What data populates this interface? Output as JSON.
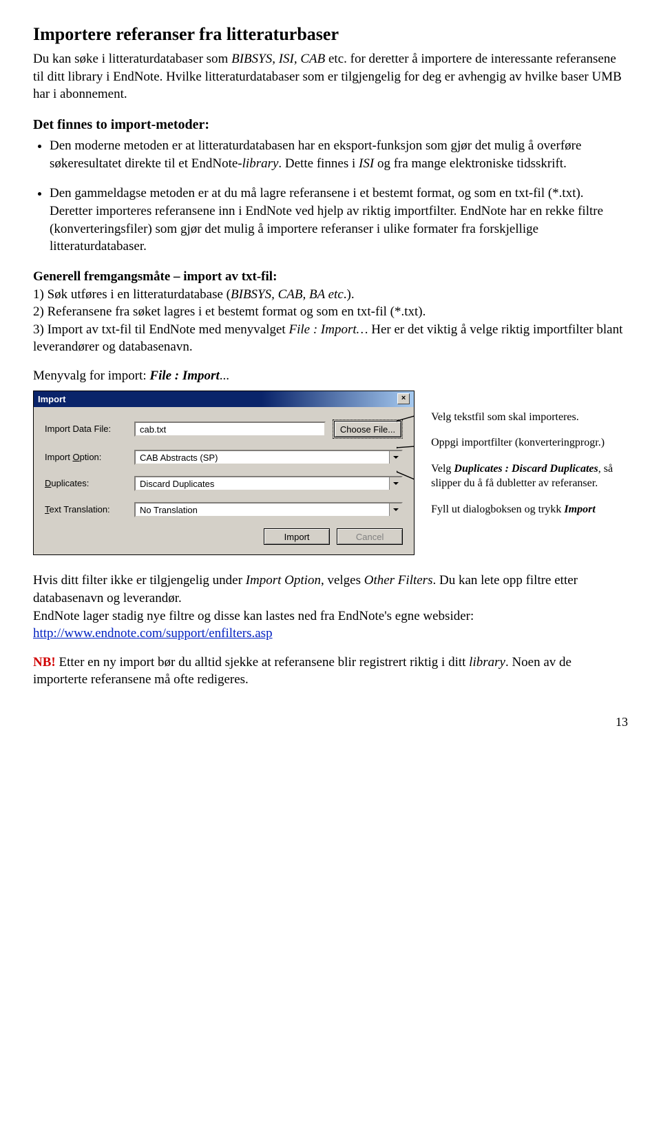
{
  "title": "Importere referanser fra litteraturbaser",
  "intro": {
    "p1_a": "Du kan søke i litteraturdatabaser som ",
    "p1_b": "BIBSYS, ISI, CAB",
    "p1_c": " etc. for deretter å importere de interessante referansene til ditt library i EndNote. Hvilke litteraturdatabaser som er tilgjengelig for deg er avhengig av hvilke baser UMB har i abonnement."
  },
  "methods_heading": "Det finnes to import-metoder:",
  "bullet1": {
    "a": "Den moderne metoden er at litteraturdatabasen har en eksport-funksjon som gjør det mulig å overføre søkeresultatet direkte til et EndNote-",
    "b": "library",
    "c": ". Dette finnes i ",
    "d": "ISI",
    "e": " og fra mange elektroniske tidsskrift."
  },
  "bullet2": "Den gammeldagse metoden er at du må lagre referansene i et bestemt format, og som en txt-fil (*.txt). Deretter importeres referansene inn i EndNote ved hjelp av riktig importfilter. EndNote har en rekke filtre (konverteringsfiler) som gjør det mulig å importere referanser i ulike formater fra forskjellige litteraturdatabaser.",
  "general_heading": "Generell fremgangsmåte – import av txt-fil:",
  "step1_a": "1) Søk utføres i en litteraturdatabase (",
  "step1_b": "BIBSYS, CAB, BA etc",
  "step1_c": ".).",
  "step2": "2) Referansene fra søket lagres i et bestemt format og som en txt-fil (*.txt).",
  "step3_a": "3) Import av txt-fil til EndNote med menyvalget ",
  "step3_b": "File : Import…",
  "step3_c": " Her er det viktig å velge riktig importfilter blant leverandører og databasenavn.",
  "menvalg_a": "Menyvalg for import: ",
  "menvalg_b": "File : Import",
  "menvalg_c": "...",
  "dialog": {
    "title": "Import",
    "labels": {
      "data_file": "Import Data File:",
      "option": "Import Option:",
      "duplicates": "Duplicates:",
      "translation": "Text Translation:"
    },
    "values": {
      "data_file": "cab.txt",
      "option": "CAB Abstracts (SP)",
      "duplicates": "Discard Duplicates",
      "translation": "No Translation"
    },
    "choose_file": "Choose File...",
    "import_btn": "Import",
    "cancel_btn": "Cancel",
    "close": "×"
  },
  "annotations": {
    "a1": "Velg tekstfil som skal importeres.",
    "a2": "Oppgi importfilter (konverteringprogr.)",
    "a3_a": "Velg ",
    "a3_b": "Duplicates : Discard Duplicates",
    "a3_c": ", så slipper du å få dubletter av referanser.",
    "a4_a": "Fyll ut dialogboksen og trykk ",
    "a4_b": "Import"
  },
  "after1_a": "Hvis ditt filter ikke er tilgjengelig under ",
  "after1_b": "Import Option",
  "after1_c": ", velges ",
  "after1_d": "Other Filters",
  "after1_e": ". Du kan lete opp filtre etter databasenavn og leverandør.",
  "after2": "EndNote lager stadig nye filtre og disse kan lastes ned fra EndNote's egne websider: ",
  "link": "http://www.endnote.com/support/enfilters.asp",
  "nb_label": "NB!",
  "nb_a": " Etter en ny import bør du alltid sjekke at referansene blir registrert riktig i ditt ",
  "nb_b": "library",
  "nb_c": ". Noen av de importerte referansene må ofte redigeres.",
  "pagenum": "13"
}
